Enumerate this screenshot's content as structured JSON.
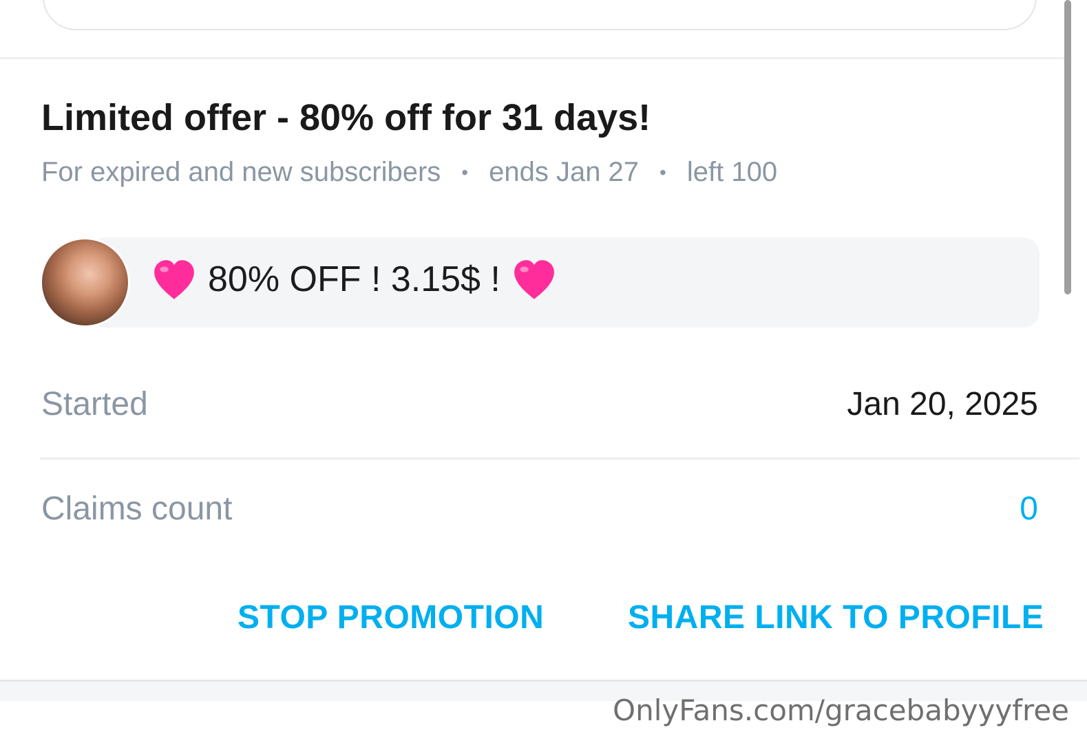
{
  "offer": {
    "title": "Limited offer - 80% off for 31 days!",
    "audience": "For expired and new subscribers",
    "ends": "ends Jan 27",
    "left": "left 100",
    "separator": "•"
  },
  "message": {
    "text": "80% OFF ! 3.15$ !",
    "heart_color": "#ff2d9b"
  },
  "details": {
    "started_label": "Started",
    "started_value": "Jan 20, 2025",
    "claims_label": "Claims count",
    "claims_value": "0"
  },
  "actions": {
    "stop_label": "STOP PROMOTION",
    "share_label": "SHARE LINK TO PROFILE"
  },
  "watermark": "OnlyFans.com/gracebabyyyfree",
  "colors": {
    "accent": "#00aff0",
    "muted": "#8a96a3",
    "text": "#1a1a1a"
  }
}
